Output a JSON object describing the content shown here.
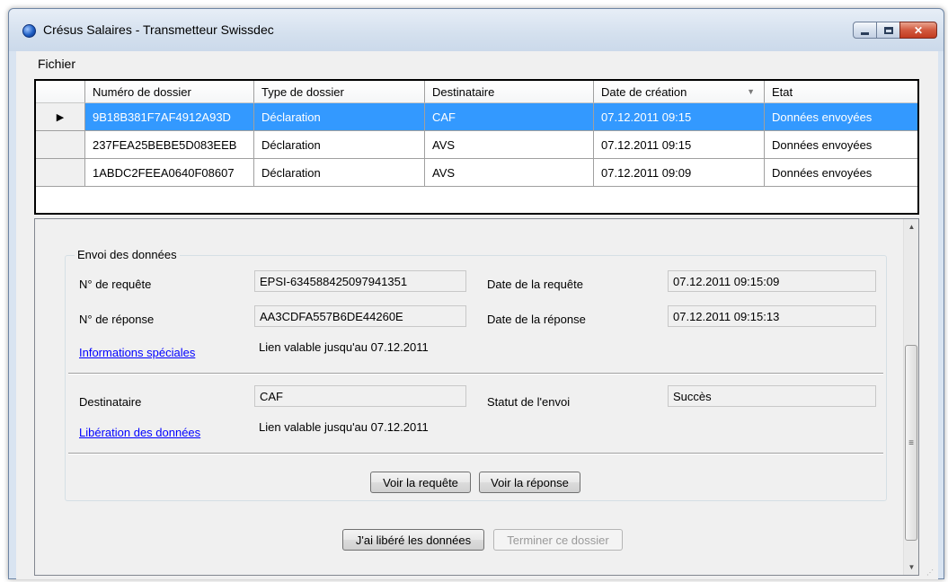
{
  "window": {
    "title": "Crésus Salaires - Transmetteur Swissdec",
    "buttons": {
      "minimize": "minimize-icon",
      "maximize": "maximize-icon",
      "close": "x"
    }
  },
  "menu": {
    "items": [
      "Fichier"
    ]
  },
  "grid": {
    "columns": [
      "Numéro de dossier",
      "Type de dossier",
      "Destinataire",
      "Date de création",
      "Etat"
    ],
    "sorted_column": "Date de création",
    "rows": [
      {
        "selected": true,
        "cells": [
          "9B18B381F7AF4912A93D",
          "Déclaration",
          "CAF",
          "07.12.2011 09:15",
          "Données envoyées"
        ]
      },
      {
        "selected": false,
        "cells": [
          "237FEA25BEBE5D083EEB",
          "Déclaration",
          "AVS",
          "07.12.2011 09:15",
          "Données envoyées"
        ]
      },
      {
        "selected": false,
        "cells": [
          "1ABDC2FEEA0640F08607",
          "Déclaration",
          "AVS",
          "07.12.2011 09:09",
          "Données envoyées"
        ]
      }
    ]
  },
  "detail": {
    "group_title": "Envoi des données",
    "request_no_label": "N° de requête",
    "request_no_value": "EPSI-634588425097941351",
    "request_date_label": "Date de la requête",
    "request_date_value": "07.12.2011 09:15:09",
    "response_no_label": "N° de réponse",
    "response_no_value": "AA3CDFA557B6DE44260E",
    "response_date_label": "Date de la réponse",
    "response_date_value": "07.12.2011 09:15:13",
    "special_info_link": "Informations spéciales",
    "special_info_validity": "Lien valable jusqu'au 07.12.2011",
    "recipient_label": "Destinataire",
    "recipient_value": "CAF",
    "send_status_label": "Statut de l'envoi",
    "send_status_value": "Succès",
    "release_link": "Libération des données",
    "release_validity": "Lien valable jusqu'au 07.12.2011",
    "view_request_button": "Voir la requête",
    "view_response_button": "Voir la réponse",
    "released_button": "J'ai libéré les données",
    "finish_button": "Terminer ce dossier"
  },
  "colors": {
    "selection": "#3399ff",
    "link": "#0000ff"
  }
}
